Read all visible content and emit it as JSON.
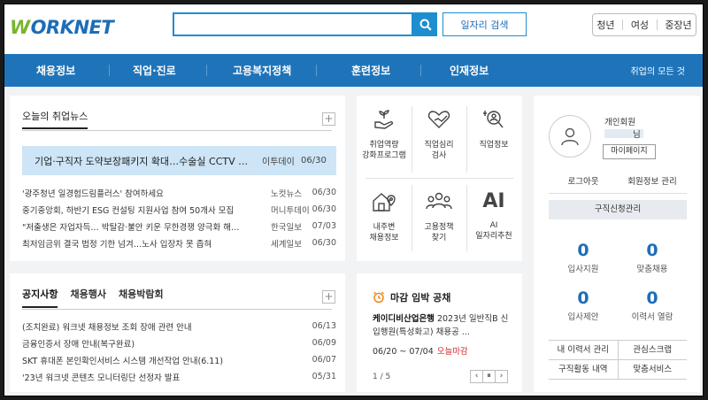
{
  "header": {
    "logo": {
      "w": "W",
      "rest": "ORKNET"
    },
    "search": {
      "placeholder": "",
      "value": ""
    },
    "job_search_label": "일자리 검색",
    "segments": [
      "청년",
      "여성",
      "중장년"
    ]
  },
  "nav": {
    "items": [
      "채용정보",
      "직업·진로",
      "고용복지정책",
      "훈련정보",
      "인재정보"
    ],
    "all_label": "취업의 모든 것"
  },
  "news": {
    "tab": "오늘의 취업뉴스",
    "plus": "+",
    "headline": {
      "title": "기업·구직자 도약보장패키지 확대…수술실 CCTV …",
      "source": "이투데이",
      "date": "06/30"
    },
    "items": [
      {
        "title": "'광주청년 일경험드림플러스' 참여하세요",
        "source": "노컷뉴스",
        "date": "06/30"
      },
      {
        "title": "중기중앙회, 하반기 ESG 컨설팅 지원사업 참여 50개사 모집",
        "source": "머니투데이",
        "date": "06/30"
      },
      {
        "title": "\"저출생은 자업자득… 박탈감·불안 키운 무한경쟁 양극화 해…",
        "source": "한국일보",
        "date": "07/03"
      },
      {
        "title": "최저임금위 결국 법정 기한 넘겨…노사 입장차 못 좁혀",
        "source": "세계일보",
        "date": "06/30"
      }
    ]
  },
  "notice": {
    "tabs": [
      "공지사항",
      "채용행사",
      "채용박람회"
    ],
    "plus": "+",
    "items": [
      {
        "title": "(조치완료) 워크넷 채용정보 조회 장애 관련 안내",
        "date": "06/13"
      },
      {
        "title": "금융인증서 장애 안내(복구완료)",
        "date": "06/09"
      },
      {
        "title": "SKT 휴대폰 본인확인서비스 시스템 개선작업 안내(6.11)",
        "date": "06/07"
      },
      {
        "title": "'23년 워크넷 콘텐츠 모니터링단 선정자 발표",
        "date": "05/31"
      }
    ]
  },
  "services": [
    {
      "icon": "seedling-hand-icon",
      "label1": "취업역량",
      "label2": "강화프로그램"
    },
    {
      "icon": "heart-hand-icon",
      "label1": "직업심리",
      "label2": "검사"
    },
    {
      "icon": "magnifier-icon",
      "label1": "직업정보",
      "label2": ""
    },
    {
      "icon": "house-pin-icon",
      "label1": "내주변",
      "label2": "채용정보"
    },
    {
      "icon": "people-icon",
      "label1": "고용정책",
      "label2": "찾기"
    },
    {
      "icon": "ai-icon",
      "label1": "AI",
      "label2": "일자리추천",
      "glyph": "AI"
    }
  ],
  "deadline": {
    "title": "마감 임박 공채",
    "company": "케이디비산업은행",
    "desc": " 2023년 일반직B 신입행원(특성화고) 채용공 ...",
    "date": "06/20 ~ 07/04",
    "tag": "오늘마감",
    "page": "1 / 5",
    "pager": [
      "‹",
      "⏸",
      "›"
    ]
  },
  "member": {
    "type": "개인회원",
    "name_suffix": "님",
    "mypage": "마이페이지",
    "logout": "로그아웃",
    "manage": "회원정보 관리",
    "job_mgmt": "구직신청관리",
    "stats": [
      {
        "n": "0",
        "label": "입사지원"
      },
      {
        "n": "0",
        "label": "맞춤채용"
      },
      {
        "n": "0",
        "label": "입사제안"
      },
      {
        "n": "0",
        "label": "이력서 열람"
      }
    ],
    "bottom": [
      [
        "내 이력서 관리",
        "관심스크랩"
      ],
      [
        "구직활동 내역",
        "맞춤서비스"
      ]
    ]
  },
  "colors": {
    "brand_blue": "#1f74b9",
    "accent_blue": "#1d8ecf",
    "green": "#79b530",
    "deadline_red": "#d9262c"
  }
}
